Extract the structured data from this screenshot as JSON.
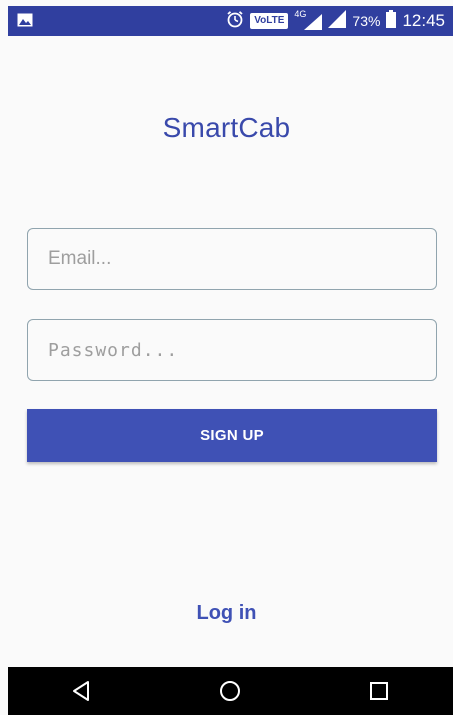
{
  "status_bar": {
    "battery_percent": "73%",
    "time": "12:45",
    "volte_label": "VoLTE",
    "network_type": "4G",
    "icons": [
      "image-icon",
      "alarm-icon",
      "signal-icon",
      "battery-icon"
    ]
  },
  "app": {
    "title": "SmartCab"
  },
  "form": {
    "email_placeholder": "Email...",
    "email_value": "",
    "password_placeholder": "Password...",
    "password_value": "",
    "signup_label": "SIGN UP"
  },
  "footer": {
    "login_label": "Log in"
  },
  "nav_bar": {
    "icons": [
      "back-icon",
      "home-icon",
      "recents-icon"
    ]
  },
  "colors": {
    "primary_dark": "#303f9f",
    "primary": "#3f51b5",
    "title_color": "#3949ab",
    "background": "#fafafa"
  }
}
